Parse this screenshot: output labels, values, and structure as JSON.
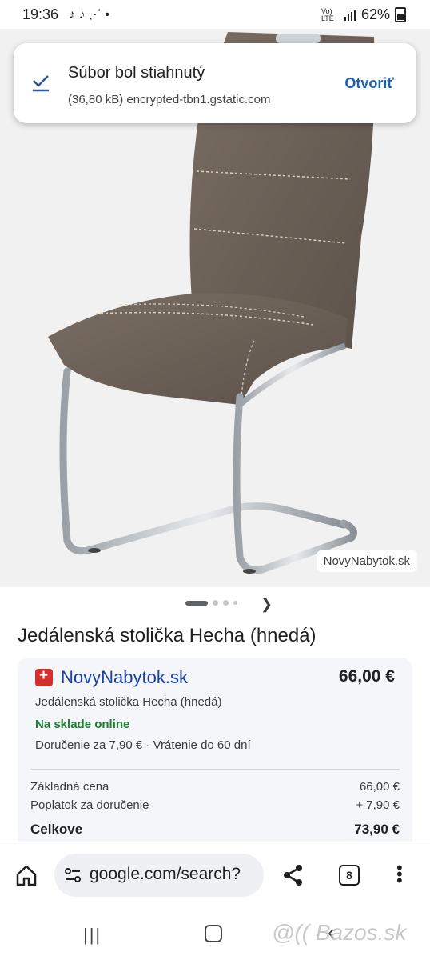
{
  "status_bar": {
    "time": "19:36",
    "left_icons": "♪ ♪ ⋰ •",
    "signal_text": "Vo) LTE",
    "battery": "62%"
  },
  "toast": {
    "title": "Súbor bol stiahnutý",
    "subtitle": "(36,80 kB) encrypted-tbn1.gstatic.com",
    "action": "Otvoriť",
    "icon": "download-check-icon"
  },
  "image": {
    "source_label": "NovyNabytok.sk",
    "carousel_pages": 4,
    "carousel_active": 1
  },
  "product": {
    "title": "Jedálenská stolička Hecha (hnedá)",
    "offer": {
      "store": "NovyNabytok.sk",
      "price": "66,00 €",
      "subtitle": "Jedálenská stolička Hecha (hnedá)",
      "availability": "Na sklade online",
      "delivery": "Doručenie za 7,90 € · Vrátenie do 60 dní",
      "breakdown": [
        {
          "label": "Základná cena",
          "value": "66,00 €"
        },
        {
          "label": "Poplatok za doručenie",
          "value": "+ 7,90 €"
        }
      ],
      "total_label": "Celkove",
      "total_value": "73,90 €"
    }
  },
  "browser": {
    "url": "google.com/search?",
    "tab_count": "8"
  },
  "watermark": "@(( Bazos.sk",
  "colors": {
    "link_blue": "#1a5fb4",
    "store_blue": "#1a3fa6",
    "in_stock_green": "#1e7e34",
    "chair_fabric": "#6e6258"
  }
}
